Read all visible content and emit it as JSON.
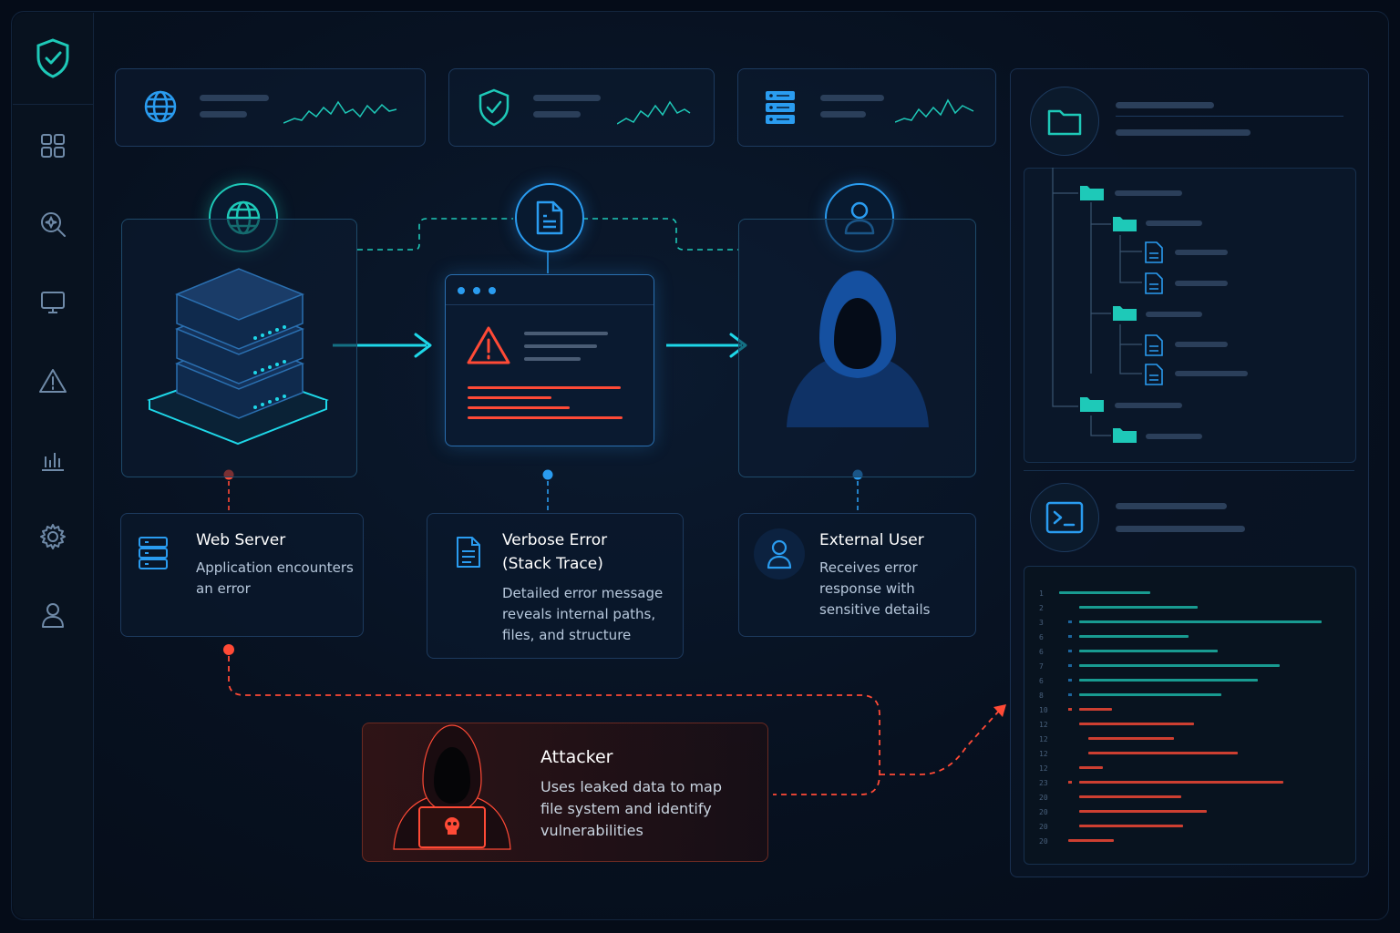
{
  "nodes": {
    "server": {
      "title": "Web Server",
      "lines": [
        "Application encounters",
        "an error"
      ]
    },
    "error": {
      "title_lines": [
        "Verbose Error",
        "(Stack Trace)"
      ],
      "lines": [
        "Detailed error message",
        "reveals internal paths,",
        "files, and structure"
      ]
    },
    "user": {
      "title": "External User",
      "lines": [
        "Receives error",
        "response with",
        "sensitive details"
      ]
    },
    "attacker": {
      "title": "Attacker",
      "lines": [
        "Uses leaked data to map",
        "file system and identify",
        "vulnerabilities"
      ]
    }
  },
  "code_line_numbers": [
    "1",
    "2",
    "3",
    "6",
    "6",
    "7",
    "6",
    "8",
    "10",
    "12",
    "12",
    "12",
    "12",
    "23",
    "20",
    "20",
    "20",
    "20"
  ],
  "colors": {
    "accent_blue": "#2a9cf0",
    "accent_teal": "#1ec9b8",
    "danger": "#ff4a36",
    "background": "#050c18"
  },
  "icons": {
    "sidebar": [
      "shield-check-icon",
      "dashboard-grid-icon",
      "search-scan-icon",
      "monitor-icon",
      "warning-icon",
      "bar-chart-icon",
      "settings-icon",
      "user-icon"
    ],
    "stats": [
      "globe-icon",
      "shield-check-icon",
      "server-icon"
    ],
    "panel": [
      "folder-icon",
      "terminal-icon"
    ]
  }
}
